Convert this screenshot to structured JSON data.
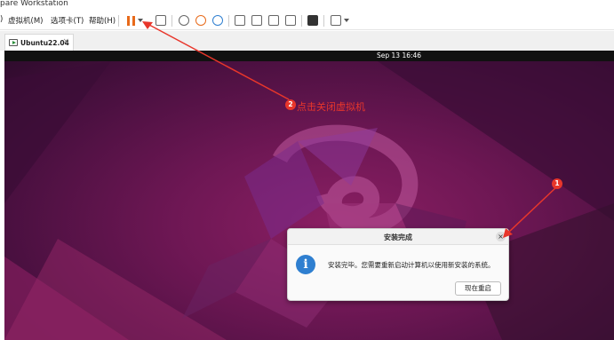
{
  "window": {
    "title": "pare Workstation"
  },
  "menubar": {
    "items": [
      {
        "label": ")"
      },
      {
        "label": "虚拟机(M)"
      },
      {
        "label": "选项卡(T)"
      },
      {
        "label": "帮助(H)"
      }
    ],
    "toolbar_icons": [
      "pause-icon",
      "dropdown-icon",
      "send-keys-icon",
      "snapshot-icon",
      "revert-snapshot-icon",
      "snapshot-manager-icon",
      "library-icon",
      "thumbnail-icon",
      "fullscreen-icon",
      "unity-icon",
      "console-icon",
      "stretch-icon"
    ]
  },
  "tabs": [
    {
      "label": "Ubuntu22.04"
    }
  ],
  "guest": {
    "clock": "Sep 13  16:46",
    "dialog": {
      "title": "安装完成",
      "message": "安装完毕。您需要重新启动计算机以使用新安装的系统。",
      "button_label": "现在重启"
    }
  },
  "annotations": {
    "badge_1": "1",
    "badge_2": "2",
    "text_2": "点击关闭虚拟机",
    "color": "#e8362b"
  },
  "colors": {
    "wallpaper_deep": "#4a1040",
    "wallpaper_accent": "#8b1f63",
    "pause": "#e86a1a",
    "info": "#2f7fd0"
  }
}
